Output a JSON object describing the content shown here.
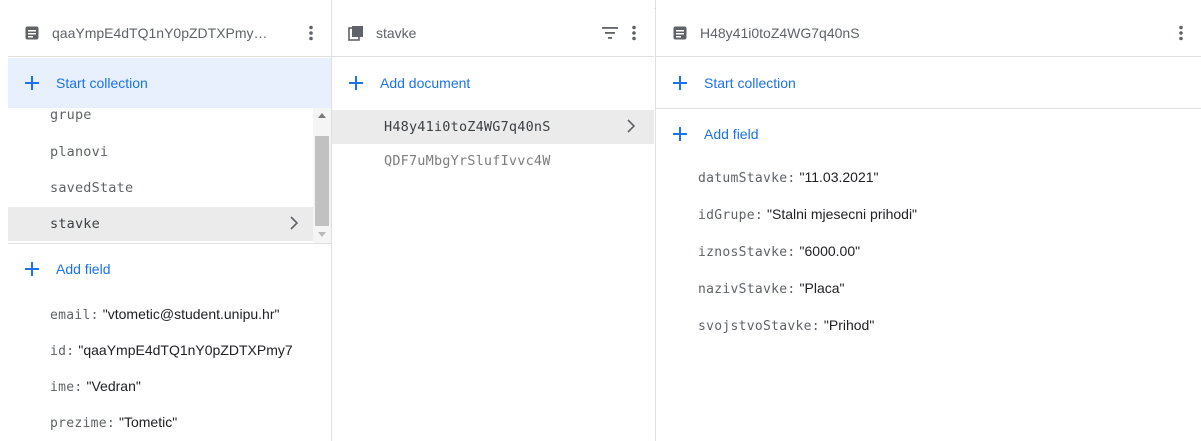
{
  "panel1": {
    "title": "qaaYmpE4dTQ1nY0pZDTXPmy…",
    "icon": "document-icon",
    "start_collection": "Start collection",
    "collections": [
      "grupe",
      "planovi",
      "savedState",
      "stavke"
    ],
    "selected_collection": "stavke",
    "add_field": "Add field",
    "fields": [
      {
        "key": "email:",
        "value": "\"vtometic@student.unipu.hr\""
      },
      {
        "key": "id:",
        "value": "\"qaaYmpE4dTQ1nY0pZDTXPmy7"
      },
      {
        "key": "ime:",
        "value": "\"Vedran\""
      },
      {
        "key": "prezime:",
        "value": "\"Tometic\""
      }
    ]
  },
  "panel2": {
    "title": "stavke",
    "icon": "collection-icon",
    "add_document": "Add document",
    "documents": [
      "H48y41i0toZ4WG7q40nS",
      "QDF7uMbgYrSlufIvvc4W"
    ],
    "selected_document": "H48y41i0toZ4WG7q40nS"
  },
  "panel3": {
    "title": "H48y41i0toZ4WG7q40nS",
    "icon": "document-icon",
    "start_collection": "Start collection",
    "add_field": "Add field",
    "fields": [
      {
        "key": "datumStavke:",
        "value": "\"11.03.2021\""
      },
      {
        "key": "idGrupe:",
        "value": "\"Stalni mjesecni prihodi\""
      },
      {
        "key": "iznosStavke:",
        "value": "\"6000.00\""
      },
      {
        "key": "nazivStavke:",
        "value": "\"Placa\""
      },
      {
        "key": "svojstvoStavke:",
        "value": "\"Prihod\""
      }
    ]
  },
  "colors": {
    "accent": "#1a73e8",
    "highlight": "#e8f0fe",
    "selected": "#ebebeb",
    "border": "#e0e0e0"
  }
}
